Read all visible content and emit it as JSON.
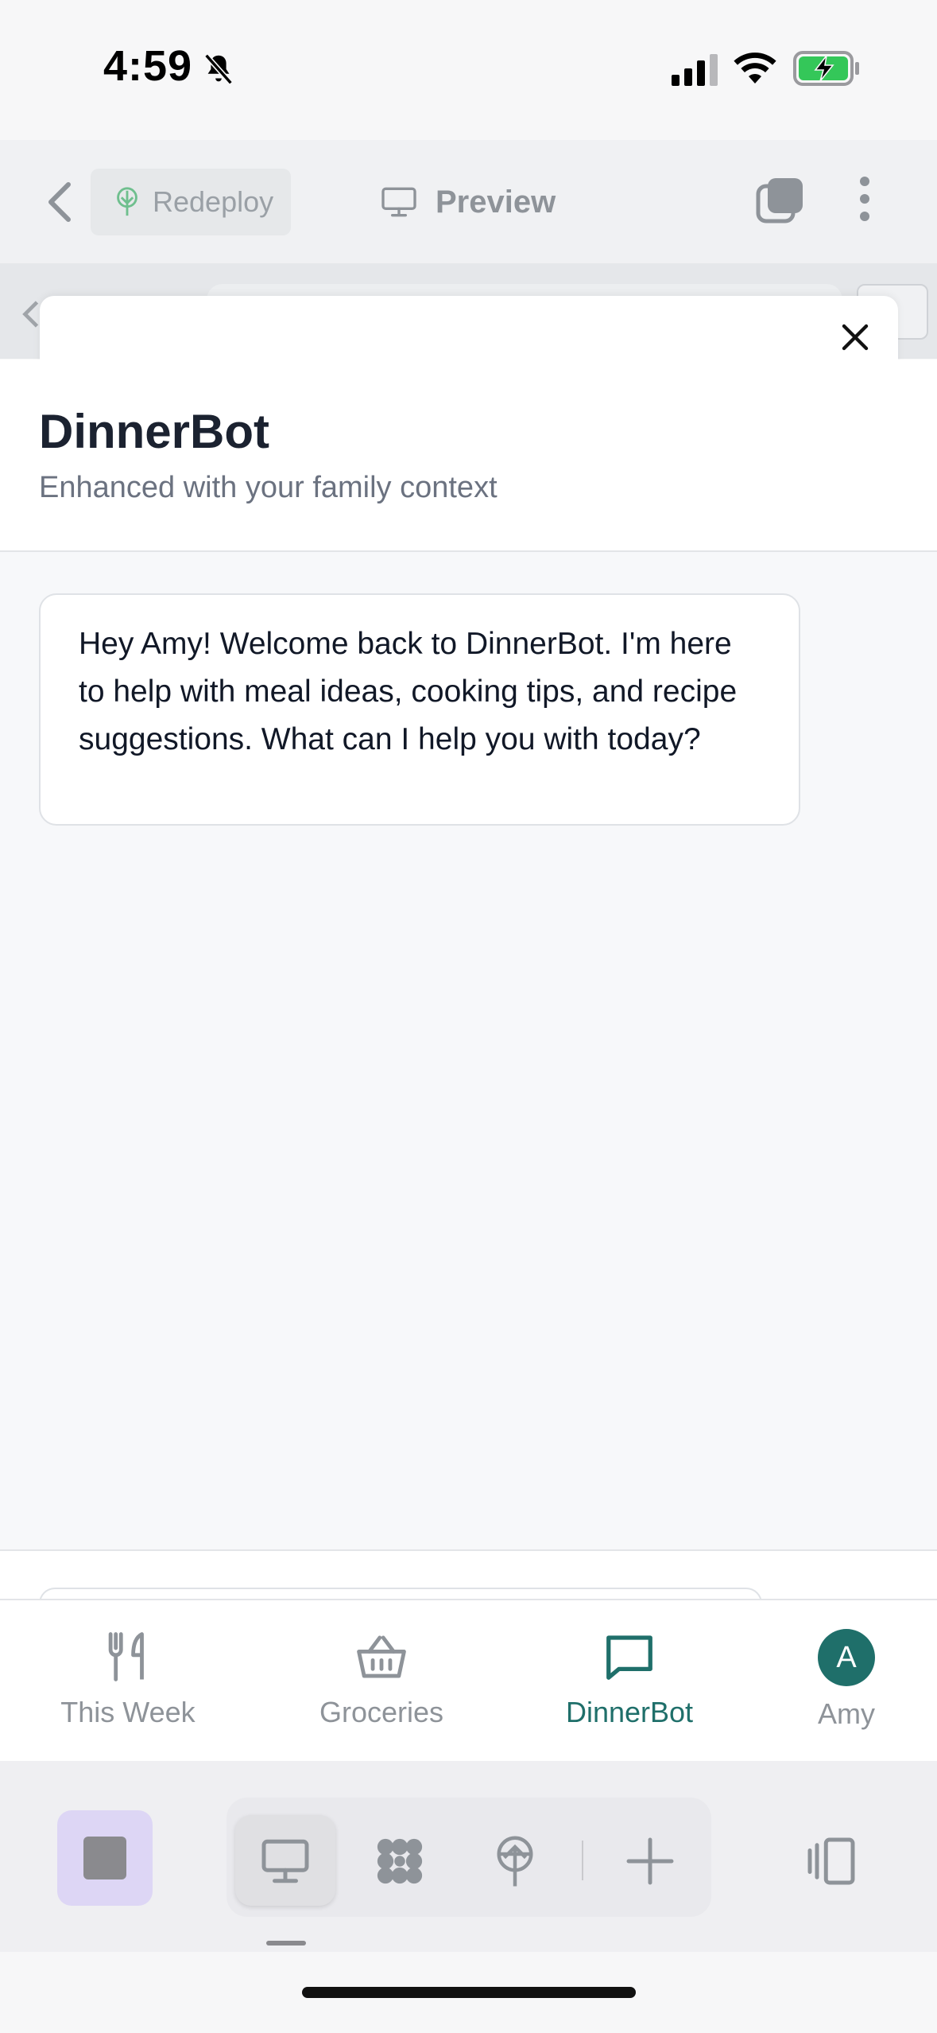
{
  "status_bar": {
    "time": "4:59",
    "icons": [
      "bell-slash-icon",
      "signal-icon",
      "wifi-icon",
      "battery-charging-icon"
    ]
  },
  "browser_toolbar": {
    "redeploy_label": "Redeploy",
    "preview_label": "Preview"
  },
  "chat": {
    "title": "DinnerBot",
    "subtitle": "Enhanced with your family context",
    "messages": [
      {
        "role": "assistant",
        "text": "Hey Amy! Welcome back to DinnerBot. I'm here to help with meal ideas, cooking tips, and recipe suggestions. What can I help you with today?"
      }
    ]
  },
  "tabbar": {
    "items": [
      {
        "label": "This Week",
        "icon": "fork-knife-icon",
        "active": false
      },
      {
        "label": "Groceries",
        "icon": "basket-icon",
        "active": false
      },
      {
        "label": "DinnerBot",
        "icon": "chat-bubble-icon",
        "active": true
      },
      {
        "label": "Amy",
        "icon": "avatar",
        "active": false
      }
    ],
    "avatar_initial": "A"
  },
  "colors": {
    "accent": "#1f6f6a",
    "muted_text": "#8e9399",
    "stop_bg": "#ddd6f5"
  }
}
